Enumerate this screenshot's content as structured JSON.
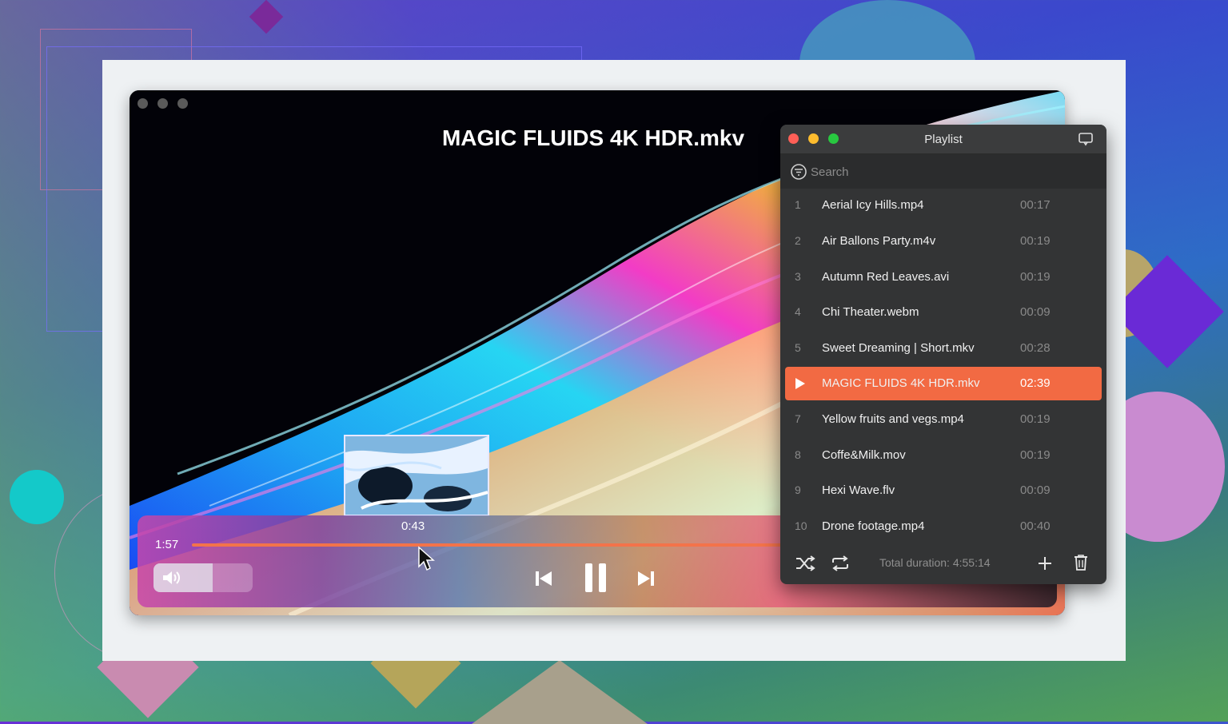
{
  "player": {
    "title": "MAGIC FLUIDS 4K HDR.mkv",
    "elapsed": "1:57",
    "preview_time": "0:43",
    "progress_fraction": 0.998,
    "volume_fraction": 0.6
  },
  "playlist": {
    "title": "Playlist",
    "search_placeholder": "Search",
    "items": [
      {
        "num": "1",
        "name": "Aerial Icy Hills.mp4",
        "duration": "00:17"
      },
      {
        "num": "2",
        "name": "Air Ballons Party.m4v",
        "duration": "00:19"
      },
      {
        "num": "3",
        "name": "Autumn Red Leaves.avi",
        "duration": "00:19"
      },
      {
        "num": "4",
        "name": "Chi Theater.webm",
        "duration": "00:09"
      },
      {
        "num": "5",
        "name": "Sweet Dreaming | Short.mkv",
        "duration": "00:28"
      },
      {
        "num": "6",
        "name": "MAGIC FLUIDS 4K HDR.mkv",
        "duration": "02:39",
        "playing": true
      },
      {
        "num": "7",
        "name": "Yellow fruits and vegs.mp4",
        "duration": "00:19"
      },
      {
        "num": "8",
        "name": "Coffe&Milk.mov",
        "duration": "00:19"
      },
      {
        "num": "9",
        "name": "Hexi Wave.flv",
        "duration": "00:09"
      },
      {
        "num": "10",
        "name": "Drone footage.mp4",
        "duration": "00:40"
      }
    ],
    "total_duration": "Total duration: 4:55:14",
    "icons": [
      "shuffle-icon",
      "repeat-icon",
      "add-icon",
      "trash-icon",
      "filter-icon",
      "mini-player-icon"
    ]
  },
  "colors": {
    "accent": "#f26a43",
    "playlist_bg": "#333435",
    "close": "#ff5f57",
    "minimize": "#febc2e",
    "zoom": "#28c840"
  }
}
